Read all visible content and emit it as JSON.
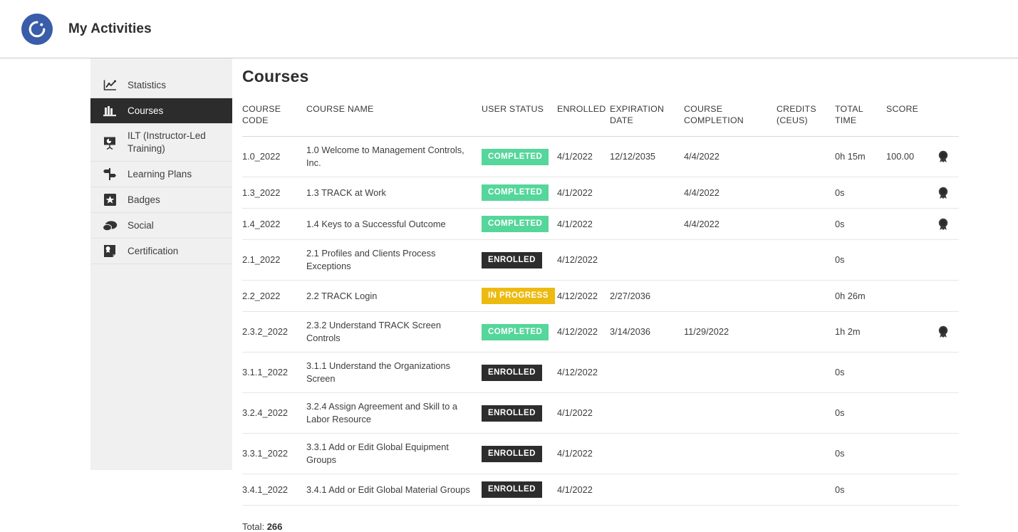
{
  "header": {
    "title": "My Activities",
    "logo_icon": "circular-arc-logo",
    "logo_color": "#3a5da9"
  },
  "sidebar": {
    "items": [
      {
        "label": "Statistics",
        "icon": "line-chart-icon",
        "active": false
      },
      {
        "label": "Courses",
        "icon": "books-icon",
        "active": true
      },
      {
        "label": "ILT (Instructor-Led Training)",
        "icon": "presentation-icon",
        "active": false
      },
      {
        "label": "Learning Plans",
        "icon": "signpost-icon",
        "active": false
      },
      {
        "label": "Badges",
        "icon": "star-badge-icon",
        "active": false
      },
      {
        "label": "Social",
        "icon": "speech-bubbles-icon",
        "active": false
      },
      {
        "label": "Certification",
        "icon": "certificate-icon",
        "active": false
      }
    ]
  },
  "main": {
    "page_title": "Courses",
    "table": {
      "columns": [
        "COURSE CODE",
        "COURSE NAME",
        "USER STATUS",
        "ENROLLED",
        "EXPIRATION DATE",
        "COURSE COMPLETION",
        "CREDITS (CEUS)",
        "TOTAL TIME",
        "SCORE"
      ],
      "rows": [
        {
          "course_code": "1.0_2022",
          "course_name": "1.0 Welcome to Management Controls, Inc.",
          "user_status": "COMPLETED",
          "status_type": "completed",
          "enrolled": "4/1/2022",
          "expiration_date": "12/12/2035",
          "course_completion": "4/4/2022",
          "credits_ceus": "",
          "total_time": "0h 15m",
          "score": "100.00",
          "award": true
        },
        {
          "course_code": "1.3_2022",
          "course_name": "1.3 TRACK at Work",
          "user_status": "COMPLETED",
          "status_type": "completed",
          "enrolled": "4/1/2022",
          "expiration_date": "",
          "course_completion": "4/4/2022",
          "credits_ceus": "",
          "total_time": "0s",
          "score": "",
          "award": true
        },
        {
          "course_code": "1.4_2022",
          "course_name": "1.4 Keys to a Successful Outcome",
          "user_status": "COMPLETED",
          "status_type": "completed",
          "enrolled": "4/1/2022",
          "expiration_date": "",
          "course_completion": "4/4/2022",
          "credits_ceus": "",
          "total_time": "0s",
          "score": "",
          "award": true
        },
        {
          "course_code": "2.1_2022",
          "course_name": "2.1 Profiles and Clients Process Exceptions",
          "user_status": "ENROLLED",
          "status_type": "enrolled",
          "enrolled": "4/12/2022",
          "expiration_date": "",
          "course_completion": "",
          "credits_ceus": "",
          "total_time": "0s",
          "score": "",
          "award": false
        },
        {
          "course_code": "2.2_2022",
          "course_name": "2.2 TRACK Login",
          "user_status": "IN PROGRESS",
          "status_type": "inprogress",
          "enrolled": "4/12/2022",
          "expiration_date": "2/27/2036",
          "course_completion": "",
          "credits_ceus": "",
          "total_time": "0h 26m",
          "score": "",
          "award": false
        },
        {
          "course_code": "2.3.2_2022",
          "course_name": "2.3.2 Understand TRACK Screen Controls",
          "user_status": "COMPLETED",
          "status_type": "completed",
          "enrolled": "4/12/2022",
          "expiration_date": "3/14/2036",
          "course_completion": "11/29/2022",
          "credits_ceus": "",
          "total_time": "1h 2m",
          "score": "",
          "award": true
        },
        {
          "course_code": "3.1.1_2022",
          "course_name": "3.1.1 Understand the Organizations Screen",
          "user_status": "ENROLLED",
          "status_type": "enrolled",
          "enrolled": "4/12/2022",
          "expiration_date": "",
          "course_completion": "",
          "credits_ceus": "",
          "total_time": "0s",
          "score": "",
          "award": false
        },
        {
          "course_code": "3.2.4_2022",
          "course_name": "3.2.4 Assign Agreement and Skill to a Labor Resource",
          "user_status": "ENROLLED",
          "status_type": "enrolled",
          "enrolled": "4/1/2022",
          "expiration_date": "",
          "course_completion": "",
          "credits_ceus": "",
          "total_time": "0s",
          "score": "",
          "award": false
        },
        {
          "course_code": "3.3.1_2022",
          "course_name": "3.3.1 Add or Edit Global Equipment Groups",
          "user_status": "ENROLLED",
          "status_type": "enrolled",
          "enrolled": "4/1/2022",
          "expiration_date": "",
          "course_completion": "",
          "credits_ceus": "",
          "total_time": "0s",
          "score": "",
          "award": false
        },
        {
          "course_code": "3.4.1_2022",
          "course_name": "3.4.1 Add or Edit Global Material Groups",
          "user_status": "ENROLLED",
          "status_type": "enrolled",
          "enrolled": "4/1/2022",
          "expiration_date": "",
          "course_completion": "",
          "credits_ceus": "",
          "total_time": "0s",
          "score": "",
          "award": false
        }
      ]
    },
    "total_label": "Total:",
    "total_count": "266"
  },
  "colors": {
    "completed_badge": "#55d69a",
    "enrolled_badge": "#2d2d2d",
    "inprogress_badge": "#edba10",
    "sidebar_bg": "#f0f0f0",
    "active_nav_bg": "#2c2c2c"
  }
}
